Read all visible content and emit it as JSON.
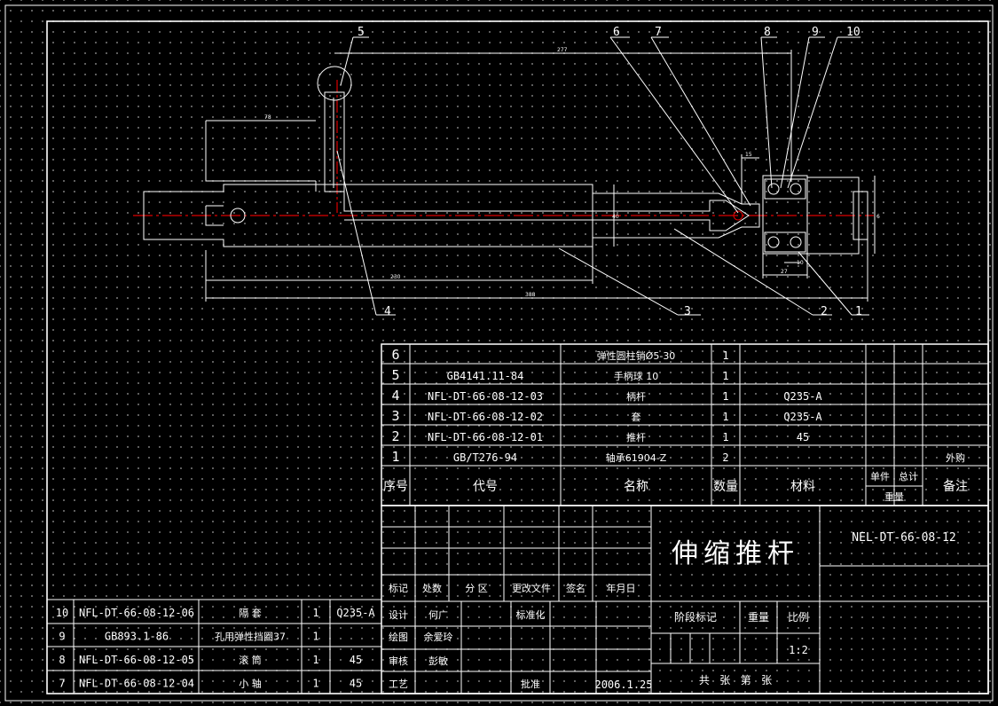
{
  "drawing": {
    "title": "伸缩推杆",
    "drawing_no": "NEL-DT-66-08-12",
    "scale": "1:2",
    "scale_label": "比例",
    "weight_label": "重量",
    "stage_label": "阶段标记",
    "sheets_label": "共   张   第   张",
    "date": "2006.1.25"
  },
  "callouts": [
    "5",
    "6",
    "7",
    "8",
    "9",
    "10",
    "4",
    "3",
    "2",
    "1"
  ],
  "dimensions": {
    "d277": "277",
    "d78": "78",
    "d230": "230",
    "d388": "388",
    "d15": "15",
    "d27": "27",
    "d10": "10",
    "d40": "40",
    "d6": "6"
  },
  "bom_header": {
    "no": "序号",
    "code": "代号",
    "name": "名称",
    "qty": "数量",
    "material": "材料",
    "unit": "单件",
    "total": "总计",
    "weight": "重量",
    "remark": "备注"
  },
  "bom_rows": [
    {
      "no": "6",
      "code": "",
      "name": "弹性圆柱销Ø5-30",
      "qty": "1",
      "material": "",
      "remark": ""
    },
    {
      "no": "5",
      "code": "GB4141.11-84",
      "name": "手柄球  10",
      "qty": "1",
      "material": "",
      "remark": ""
    },
    {
      "no": "4",
      "code": "NFL-DT-66-08-12-03",
      "name": "柄杆",
      "qty": "1",
      "material": "Q235-A",
      "remark": ""
    },
    {
      "no": "3",
      "code": "NFL-DT-66-08-12-02",
      "name": "套",
      "qty": "1",
      "material": "Q235-A",
      "remark": ""
    },
    {
      "no": "2",
      "code": "NFL-DT-66-08-12-01",
      "name": "推杆",
      "qty": "1",
      "material": "45",
      "remark": ""
    },
    {
      "no": "1",
      "code": "GB/T276-94",
      "name": "轴承61904-Z",
      "qty": "2",
      "material": "",
      "remark": "外购"
    }
  ],
  "lower_bom": [
    {
      "no": "10",
      "code": "NFL-DT-66-08-12-06",
      "name": "隔  套",
      "qty": "1",
      "material": "Q235-A"
    },
    {
      "no": "9",
      "code": "GB893.1-86",
      "name": "孔用弹性挡圈37",
      "qty": "1",
      "material": ""
    },
    {
      "no": "8",
      "code": "NFL-DT-66-08-12-05",
      "name": "滚  筒",
      "qty": "1",
      "material": "45"
    },
    {
      "no": "7",
      "code": "NFL-DT-66-08-12-04",
      "name": "小  轴",
      "qty": "1",
      "material": "45"
    }
  ],
  "change_header": [
    "标记",
    "处数",
    "分 区",
    "更改文件",
    "签名",
    "年月日"
  ],
  "signoff": [
    {
      "role": "设计",
      "name": "何广",
      "role2": "标准化",
      "name2": ""
    },
    {
      "role": "绘图",
      "name": "余爱玲",
      "role2": "",
      "name2": ""
    },
    {
      "role": "审核",
      "name": "彭敏",
      "role2": "",
      "name2": ""
    },
    {
      "role": "工艺",
      "name": "",
      "role2": "批准",
      "name2": ""
    }
  ]
}
